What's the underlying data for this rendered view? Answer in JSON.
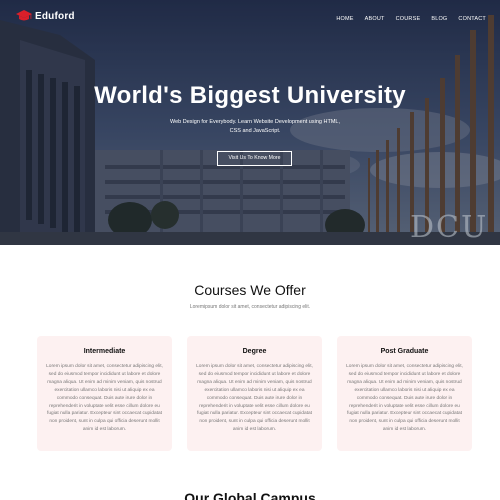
{
  "nav": {
    "brand": "Eduford",
    "items": [
      {
        "label": "HOME"
      },
      {
        "label": "ABOUT"
      },
      {
        "label": "COURSE"
      },
      {
        "label": "BLOG"
      },
      {
        "label": "CONTACT"
      }
    ]
  },
  "hero": {
    "title": "World's Biggest University",
    "subtitle": "Web Design for Everybody. Learn Website Development using HTML, CSS and JavaScript.",
    "button": "Visit Us To Know More",
    "sign_text": "DCU"
  },
  "courses": {
    "title": "Courses We Offer",
    "subtitle": "Loremipsum dolor sit amet, consectetur adipiscing elit.",
    "cards": [
      {
        "title": "Intermediate",
        "text": "Lorem ipsum dolor sit amet, consectetur adipiscing elit, sed do eiusmod tempor incididunt ut labore et dolore magna aliqua. Ut enim ad minim veniam, quis nostrud exercitation ullamco laboris nisi ut aliquip ex ea commodo consequat. Duis aute irure dolor in reprehenderit in voluptate velit esse cillum dolore eu fugiat nulla pariatur. Excepteur sint occaecat cupidatat non proident, sunt in culpa qui officia deserunt mollit anim id est laborum."
      },
      {
        "title": "Degree",
        "text": "Lorem ipsum dolor sit amet, consectetur adipiscing elit, sed do eiusmod tempor incididunt ut labore et dolore magna aliqua. Ut enim ad minim veniam, quis nostrud exercitation ullamco laboris nisi ut aliquip ex ea commodo consequat. Duis aute irure dolor in reprehenderit in voluptate velit esse cillum dolore eu fugiat nulla pariatur. Excepteur sint occaecat cupidatat non proident, sunt in culpa qui officia deserunt mollit anim id est laborum."
      },
      {
        "title": "Post Graduate",
        "text": "Lorem ipsum dolor sit amet, consectetur adipiscing elit, sed do eiusmod tempor incididunt ut labore et dolore magna aliqua. Ut enim ad minim veniam, quis nostrud exercitation ullamco laboris nisi ut aliquip ex ea commodo consequat. Duis aute irure dolor in reprehenderit in voluptate velit esse cillum dolore eu fugiat nulla pariatur. Excepteur sint occaecat cupidatat non proident, sunt in culpa qui officia deserunt mollit anim id est laborum."
      }
    ]
  },
  "global": {
    "title": "Our Global Campus"
  },
  "colors": {
    "logo_accent": "#d91f2a",
    "card_bg": "#fdf1f1",
    "hero_overlay": "#0e1630"
  }
}
